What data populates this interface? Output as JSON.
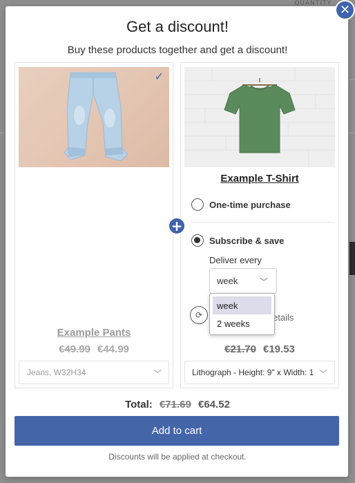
{
  "background": {
    "quantity_label": "QUANTITY"
  },
  "modal": {
    "close_icon": "close-icon",
    "title": "Get a discount!",
    "subtitle": "Buy these products together and get a discount!"
  },
  "products": [
    {
      "name": "Example Pants",
      "old_price": "€49.99",
      "new_price": "€44.99",
      "variant": "Jeans, W32H34",
      "selected": true,
      "image_icon": "jeans-image"
    },
    {
      "name": "Example T-Shirt",
      "old_price": "€21.70",
      "new_price": "€19.53",
      "variant": "Lithograph - Height: 9\" x Width: 1",
      "image_icon": "tshirt-image",
      "purchase_options": {
        "one_time_label": "One-time purchase",
        "subscribe_label": "Subscribe & save",
        "selected": "subscribe",
        "deliver_label": "Deliver every",
        "deliver_value": "week",
        "deliver_options": [
          "week",
          "2 weeks"
        ],
        "details_text": "etails"
      }
    }
  ],
  "total": {
    "label": "Total:",
    "old_price": "€71.69",
    "new_price": "€64.52"
  },
  "cart_button_label": "Add to cart",
  "footnote": "Discounts will be applied at checkout.",
  "colors": {
    "accent": "#4565a9",
    "close": "#3f64ad"
  }
}
